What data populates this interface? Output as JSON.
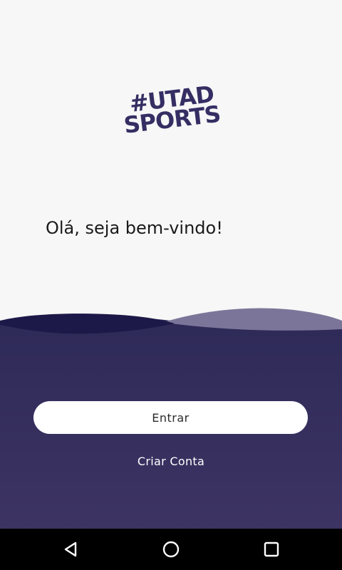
{
  "logo": {
    "line1": "#UTAD",
    "line2": "SPORTS",
    "color": "#352e63"
  },
  "greeting": "Olá, seja bem-vindo!",
  "actions": {
    "login_label": "Entrar",
    "signup_label": "Criar Conta"
  },
  "theme": {
    "background": "#f7f7f7",
    "primary_dark": "#2f2a5a",
    "wave_dark": "#1c1948",
    "wave_light": "#7a7599",
    "button_bg": "#ffffff"
  },
  "navbar": {
    "items": [
      {
        "icon": "back-icon"
      },
      {
        "icon": "home-icon"
      },
      {
        "icon": "recents-icon"
      }
    ]
  }
}
